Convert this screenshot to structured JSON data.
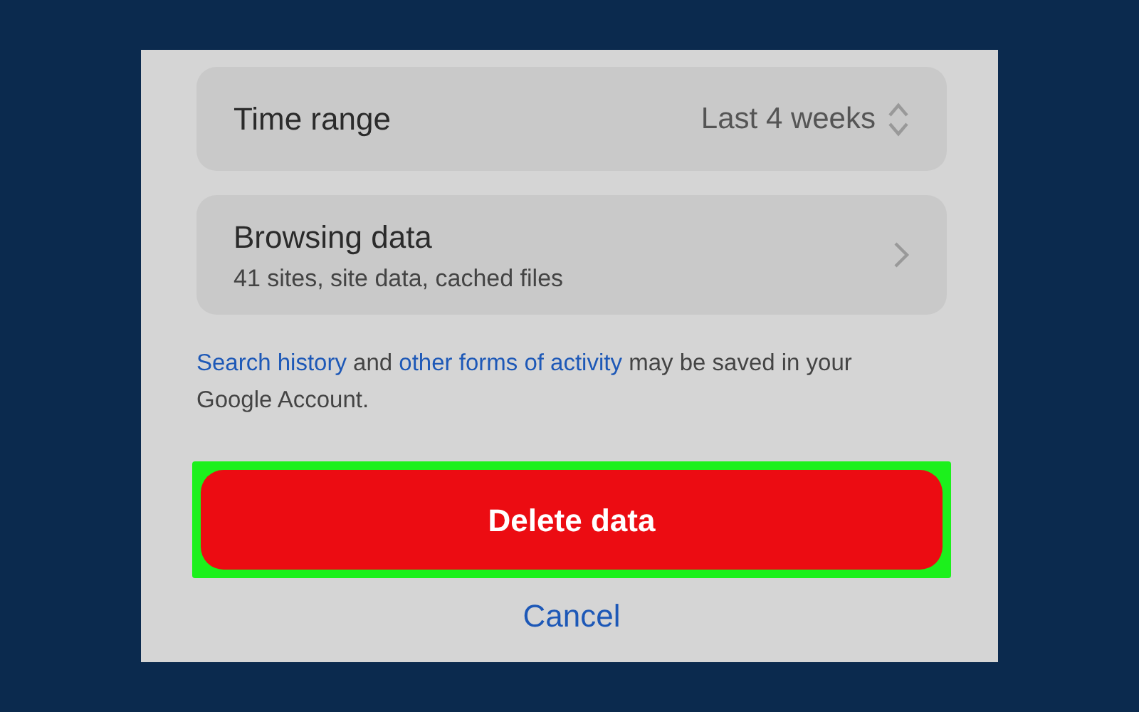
{
  "time_range": {
    "label": "Time range",
    "value": "Last 4 weeks"
  },
  "browsing_data": {
    "title": "Browsing data",
    "subtitle": "41 sites, site data, cached files"
  },
  "notice": [
    {
      "kind": "link",
      "text": "Search history"
    },
    {
      "kind": "text",
      "text": " and "
    },
    {
      "kind": "link",
      "text": "other forms of activity"
    },
    {
      "kind": "text",
      "text": " may be saved in your Google Account."
    }
  ],
  "delete_button": {
    "label": "Delete data",
    "highlighted": true
  },
  "cancel": {
    "label": "Cancel"
  }
}
